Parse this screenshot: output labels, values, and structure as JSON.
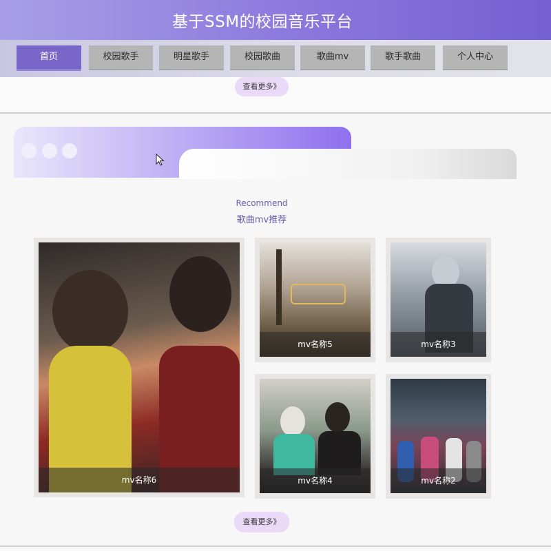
{
  "header": {
    "title": "基于SSM的校园音乐平台"
  },
  "nav": {
    "items": [
      {
        "label": "首页",
        "active": true
      },
      {
        "label": "校园歌手",
        "active": false
      },
      {
        "label": "明星歌手",
        "active": false
      },
      {
        "label": "校园歌曲",
        "active": false
      },
      {
        "label": "歌曲mv",
        "active": false
      },
      {
        "label": "歌手歌曲",
        "active": false
      },
      {
        "label": "个人中心",
        "active": false
      }
    ]
  },
  "section_top": {
    "more_label": "查看更多》"
  },
  "recommend": {
    "title_en": "Recommend",
    "title_zh": "歌曲mv推荐",
    "cards": [
      {
        "caption": "mv名称6"
      },
      {
        "caption": "mv名称5"
      },
      {
        "caption": "mv名称3"
      },
      {
        "caption": "mv名称4"
      },
      {
        "caption": "mv名称2"
      }
    ],
    "more_label": "查看更多》"
  },
  "colors": {
    "accent": "#7a66c8",
    "header_gradient_end": "#7460d0",
    "more_button_bg": "#ead9f7"
  }
}
